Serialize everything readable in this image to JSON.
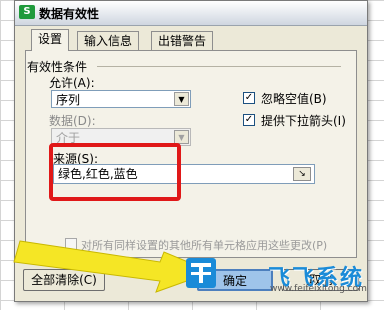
{
  "window": {
    "title": "数据有效性",
    "app_icon_letter": "S"
  },
  "tabs": [
    {
      "label": "设置",
      "active": true
    },
    {
      "label": "输入信息",
      "active": false
    },
    {
      "label": "出错警告",
      "active": false
    }
  ],
  "validity_conditions": {
    "group_label": "有效性条件",
    "allow_label": "允许(A):",
    "allow_value": "序列",
    "data_label": "数据(D):",
    "data_value": "介于",
    "ignore_blank_label": "忽略空值(B)",
    "ignore_blank_checked": true,
    "dropdown_label": "提供下拉箭头(I)",
    "dropdown_checked": true
  },
  "source": {
    "label": "来源(S):",
    "value": "绿色,红色,蓝色"
  },
  "apply_all": {
    "label": "对所有同样设置的其他所有单元格应用这些更改(P)",
    "checked": false
  },
  "buttons": {
    "clear_all": "全部清除(C)",
    "ok": "确定",
    "cancel": "取消"
  },
  "watermark": {
    "brand": "飞飞系统",
    "url": "www.feifeixitong.com"
  },
  "colors": {
    "highlight_box": "#e01818",
    "arrow": "#f5e625",
    "watermark": "#1a8bd8"
  }
}
